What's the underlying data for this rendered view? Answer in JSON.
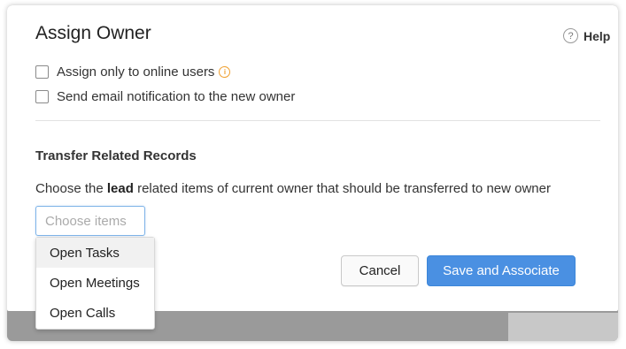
{
  "dialog": {
    "title": "Assign Owner",
    "help_label": "Help",
    "help_icon": "?",
    "options": [
      {
        "label": "Assign only to online users",
        "checked": false,
        "info_icon": "i"
      },
      {
        "label": "Send email notification to the new owner",
        "checked": false
      }
    ],
    "section_title": "Transfer Related Records",
    "description_before": "Choose the ",
    "description_bold": "lead",
    "description_after": " related items of current owner that should be transferred to new owner",
    "choose_placeholder": "Choose items",
    "dropdown_items": [
      "Open Tasks",
      "Open Meetings",
      "Open Calls"
    ],
    "cancel_label": "Cancel",
    "save_label": "Save and Associate"
  },
  "colors": {
    "primary": "#4a90e2",
    "info_accent": "#f0a030"
  }
}
